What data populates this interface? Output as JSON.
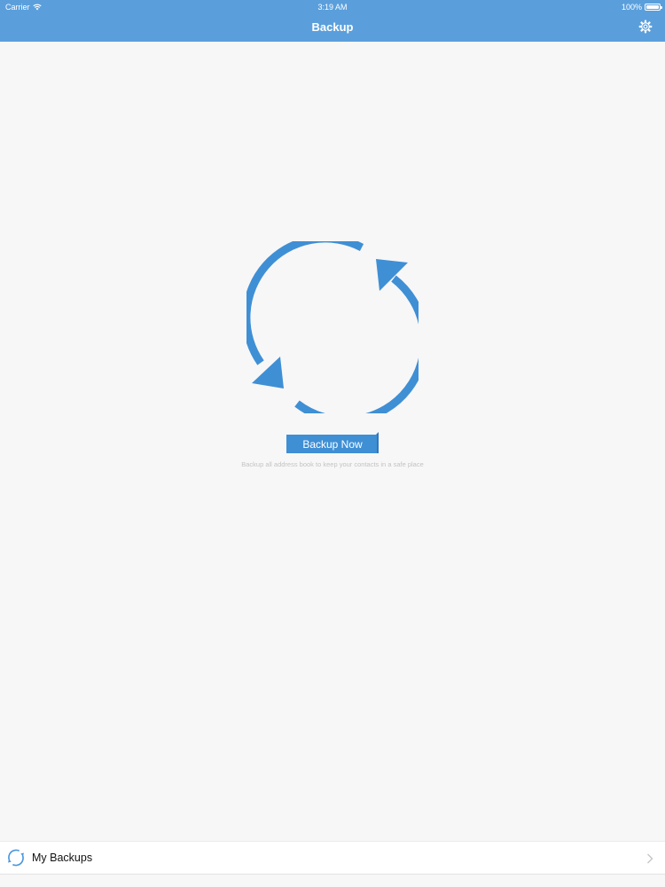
{
  "status_bar": {
    "carrier": "Carrier",
    "time": "3:19 AM",
    "battery": "100%",
    "icons": [
      "wifi-icon",
      "battery-icon"
    ]
  },
  "nav": {
    "title": "Backup",
    "settings_icon": "gear-icon"
  },
  "main": {
    "graphic_icon": "sync-arrows-icon",
    "backup_button_label": "Backup Now",
    "subtitle": "Backup all address book to keep your contacts in a safe place"
  },
  "bottom": {
    "row_label": "My Backups",
    "row_icon": "sync-icon",
    "chevron_icon": "chevron-right-icon"
  },
  "colors": {
    "accent": "#5a9fdc",
    "button": "#3f8fd5",
    "graphic": "#3f8fd5",
    "background": "#f7f7f7"
  }
}
